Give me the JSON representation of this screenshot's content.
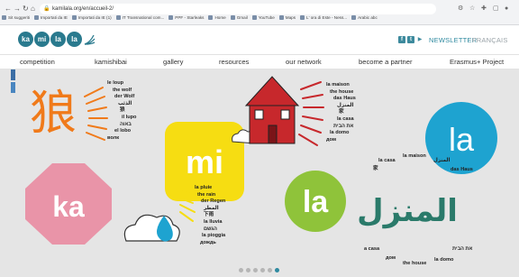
{
  "browser": {
    "url": "kamilala.org/en/accueil-2/",
    "nav": {
      "back": "←",
      "forward": "→",
      "reload": "↻",
      "home": "⌂"
    },
    "bookmarks": [
      "Sit suggeriti",
      "Importati da IE",
      "Importati da IE (1)",
      "IT Transnational com...",
      "PPF - Starleaks",
      "Home",
      "Gmail",
      "YouTube",
      "Maps",
      "L' ora di Este - Ness...",
      "Arabic abc"
    ]
  },
  "header": {
    "logo_letters": [
      "ka",
      "mi",
      "la",
      "la"
    ],
    "social": [
      "f",
      "t",
      "▶"
    ],
    "newsletter": "NEWSLETTER",
    "language": "FRANÇAIS"
  },
  "nav": [
    "competition",
    "kamishibai",
    "gallery",
    "resources",
    "our network",
    "become a partner",
    "Erasmus+ Project"
  ],
  "hero": {
    "wolf": {
      "glyph": "狼",
      "words": [
        "le loup",
        "the wolf",
        "der Wolf",
        "الذئب",
        "狼",
        "il lupo",
        "באוה",
        "el lobo",
        "волк"
      ]
    },
    "house": {
      "words": [
        "la maison",
        "the house",
        "das Haus",
        "المنزل",
        "家",
        "la casa",
        "את הבית",
        "la domo",
        "дом"
      ]
    },
    "rain": {
      "words": [
        "la pluie",
        "the rain",
        "der Regen",
        "المطر",
        "下雨",
        "la lluvia",
        "הגשם",
        "la pioggia",
        "дождь"
      ]
    },
    "circles": {
      "ka": "ka",
      "mi": "mi",
      "la_green": "la",
      "la_blue": "la"
    },
    "arabic_big": "المنزل",
    "scatter": {
      "la_casa": "la casa",
      "ja": "家",
      "la_maison": "la maison",
      "ar_small": "المنزل",
      "das_haus": "das Haus",
      "a_casa": "a casa",
      "dom": "дом",
      "the_house": "the house",
      "la_domo": "la domo",
      "heb": "את הבית"
    }
  },
  "slider": {
    "count": 6,
    "active": 5
  },
  "colors": {
    "teal": "#2a7a8e",
    "orange": "#f07a1a",
    "pink": "#e994a8",
    "yellow": "#f6dd12",
    "green": "#8fc33a",
    "blue": "#1ea3d0",
    "red": "#c7282c"
  }
}
